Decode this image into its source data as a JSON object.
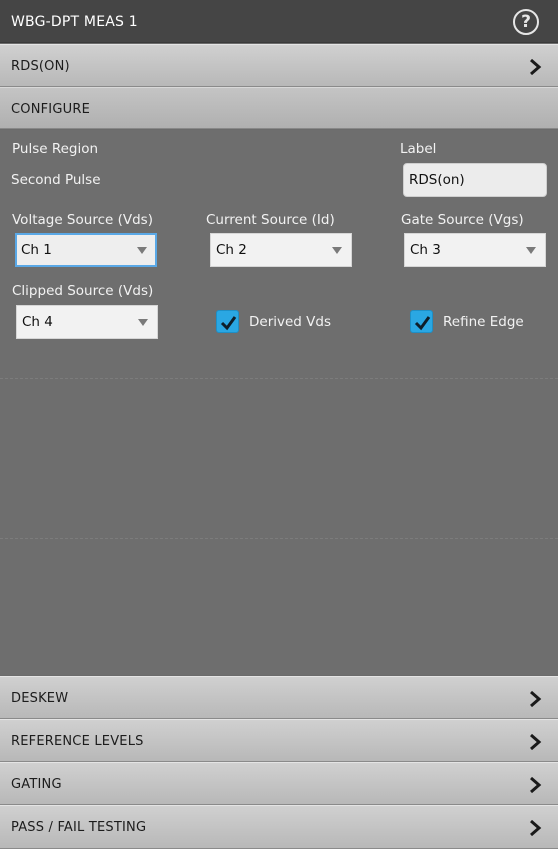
{
  "window": {
    "title": "WBG-DPT MEAS 1",
    "help_icon": "help-icon",
    "help_glyph": "?"
  },
  "measurement_bar": {
    "label": "RDS(ON)",
    "icon": "chevron-right-icon"
  },
  "configure": {
    "header": "CONFIGURE",
    "pulse_region_label": "Pulse Region",
    "pulse_region_value": "Second Pulse",
    "label_field": {
      "label": "Label",
      "value": "RDS(on)"
    },
    "voltage_source": {
      "label": "Voltage Source (Vds)",
      "value": "Ch 1"
    },
    "current_source": {
      "label": "Current Source (Id)",
      "value": "Ch 2"
    },
    "gate_source": {
      "label": "Gate Source (Vgs)",
      "value": "Ch 3"
    },
    "clipped_source": {
      "label": "Clipped Source (Vds)",
      "value": "Ch 4"
    },
    "derived_vds": {
      "label": "Derived Vds",
      "checked": true
    },
    "refine_edge": {
      "label": "Refine Edge",
      "checked": true
    }
  },
  "sections": [
    {
      "label": "DESKEW",
      "icon": "chevron-right-icon"
    },
    {
      "label": "REFERENCE LEVELS",
      "icon": "chevron-right-icon"
    },
    {
      "label": "GATING",
      "icon": "chevron-right-icon"
    },
    {
      "label": "PASS / FAIL TESTING",
      "icon": "chevron-right-icon"
    }
  ],
  "colors": {
    "accent": "#2aa7e3",
    "panel": "#6e6e6e",
    "titlebar": "#454545",
    "focus": "#5aa8e6"
  }
}
